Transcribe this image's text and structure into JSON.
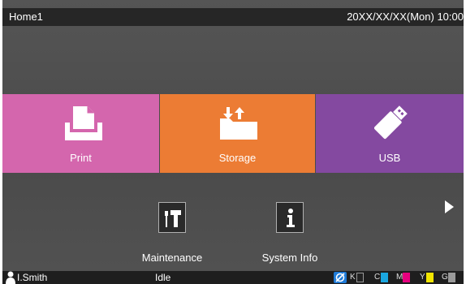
{
  "header": {
    "title": "Home1",
    "datetime": "20XX/XX/XX(Mon) 10:00"
  },
  "tiles": [
    {
      "label": "Print",
      "icon": "print-icon",
      "color": "#d466ad"
    },
    {
      "label": "Storage",
      "icon": "storage-icon",
      "color": "#ec7c34"
    },
    {
      "label": "USB",
      "icon": "usb-icon",
      "color": "#8449a0"
    }
  ],
  "functions": [
    {
      "label": "Maintenance",
      "icon": "maintenance-icon"
    },
    {
      "label": "System Info",
      "icon": "info-icon"
    }
  ],
  "navigation": {
    "next": "next-page-arrow-icon"
  },
  "status": {
    "user": "I.Smith",
    "state": "Idle",
    "inks": [
      {
        "label": "K",
        "color": "#ffffff"
      },
      {
        "label": "C",
        "color": "#1aa7e0"
      },
      {
        "label": "M",
        "color": "#e6007e"
      },
      {
        "label": "Y",
        "color": "#f2e500"
      },
      {
        "label": "G",
        "color": "#9a9a9a"
      }
    ]
  }
}
